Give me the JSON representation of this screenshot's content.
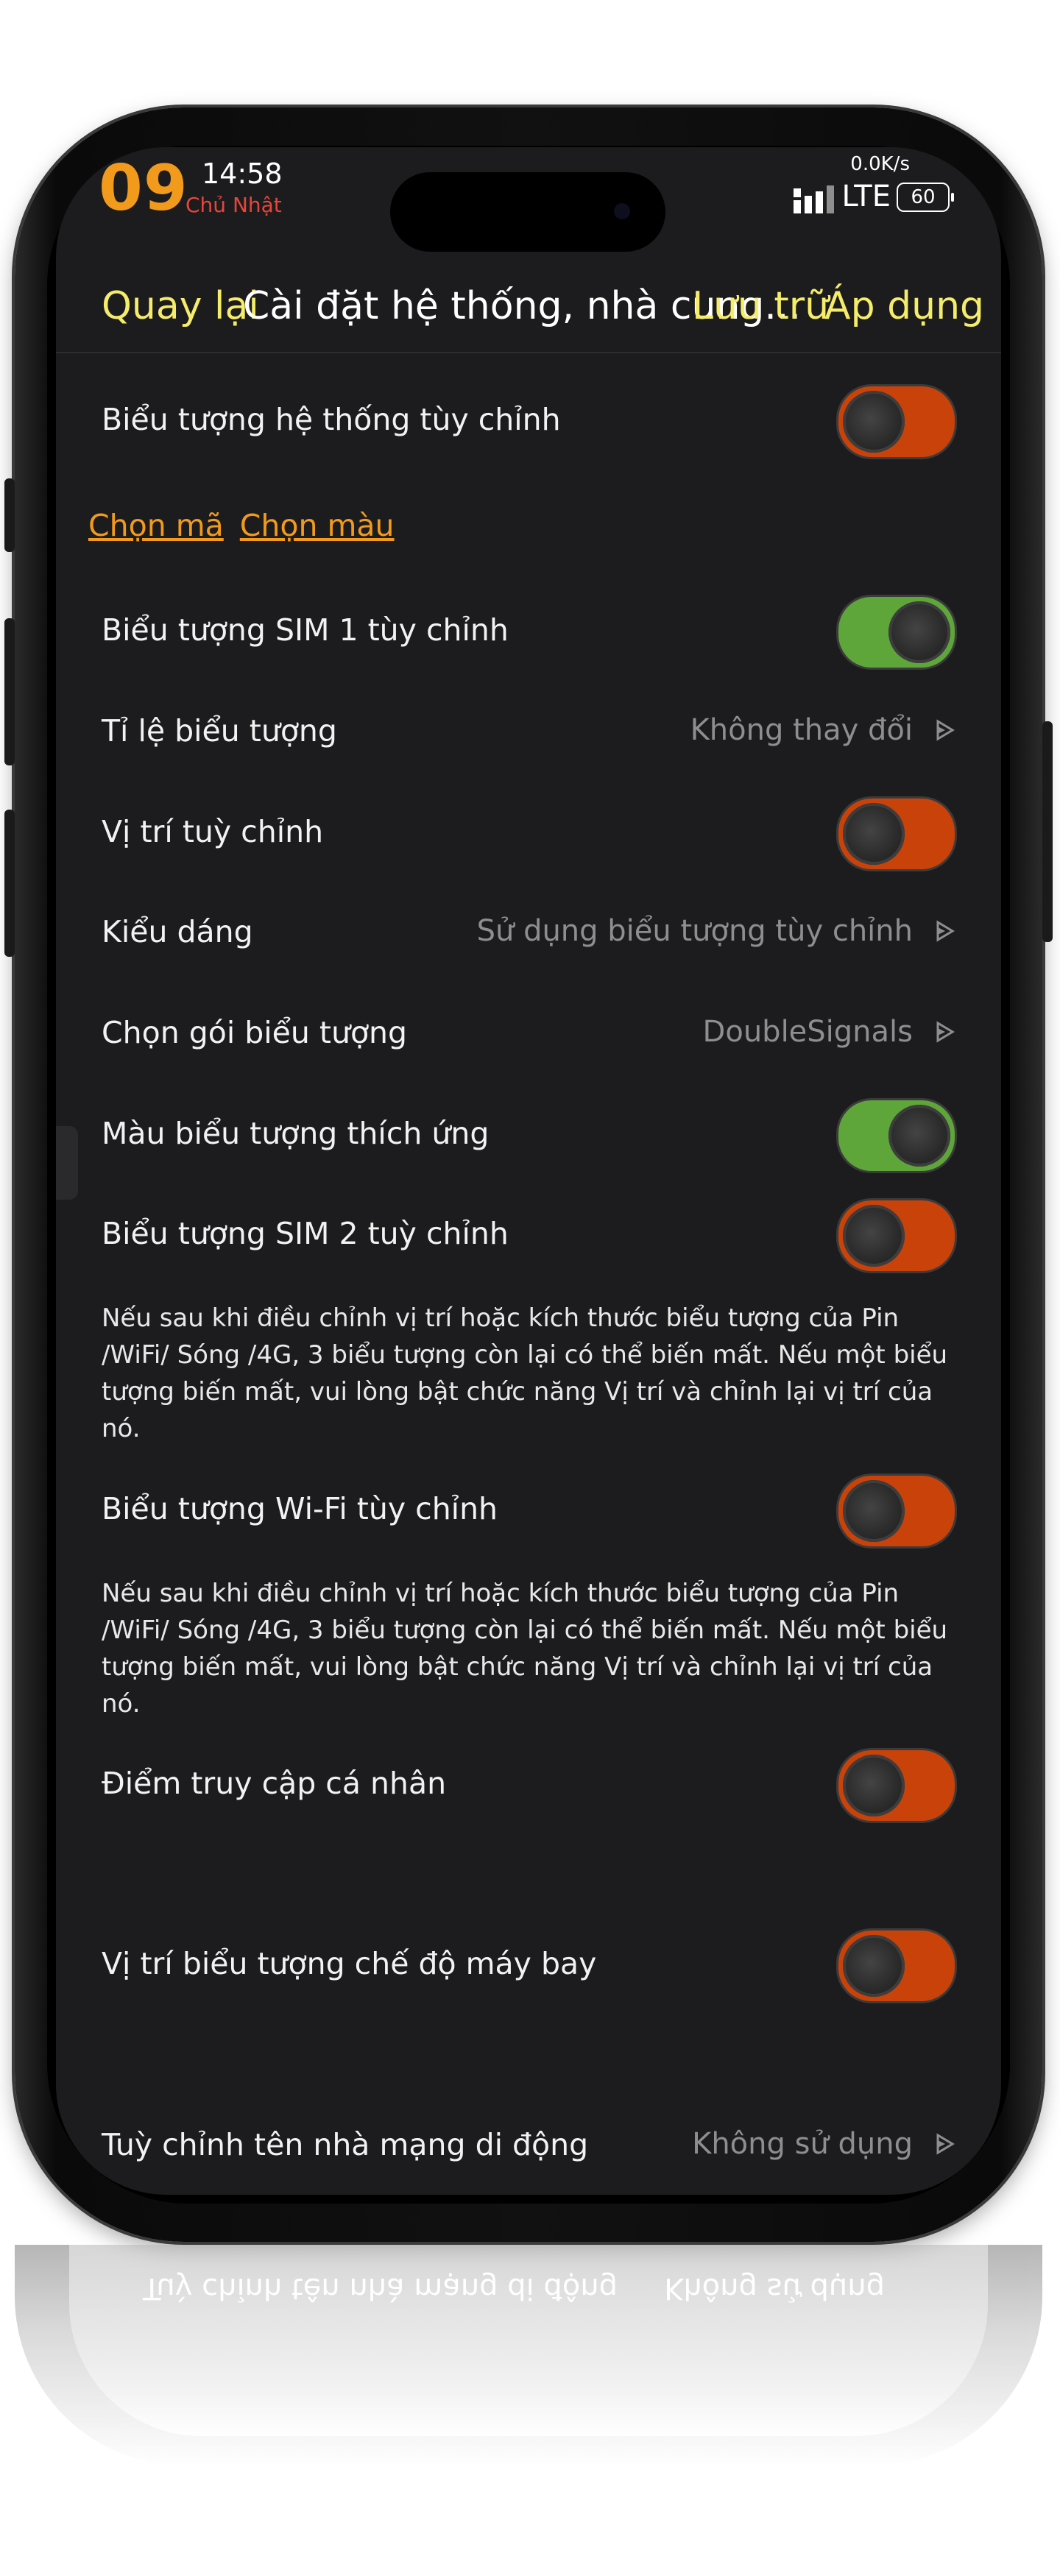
{
  "status_bar": {
    "day": "09",
    "time": "14:58",
    "weekday": "Chủ Nhật",
    "speed": "0.0K/s",
    "network": "LTE",
    "battery": "60"
  },
  "nav": {
    "back": "Quay lại",
    "title": "Cài đặt hệ thống, nhà cung...",
    "save": "Lưu trữ",
    "apply": "Áp dụng"
  },
  "settings": {
    "custom_system_icons": {
      "label": "Biểu tượng hệ thống tùy chỉnh",
      "enabled": false
    },
    "links": {
      "choose_code": "Chọn mã",
      "choose_color": "Chọn màu"
    },
    "custom_sim1_icon": {
      "label": "Biểu tượng SIM 1 tùy chỉnh",
      "enabled": true
    },
    "icon_ratio": {
      "label": "Tỉ lệ biểu tượng",
      "value": "Không thay đổi"
    },
    "custom_position": {
      "label": "Vị trí tuỳ chỉnh",
      "enabled": false
    },
    "style": {
      "label": "Kiểu dáng",
      "value": "Sử dụng biểu tượng tùy chỉnh"
    },
    "icon_pack": {
      "label": "Chọn gói biểu tượng",
      "value": "DoubleSignals"
    },
    "adaptive_color": {
      "label": "Màu biểu tượng thích ứng",
      "enabled": true
    },
    "custom_sim2_icon": {
      "label": "Biểu tượng SIM 2 tuỳ chỉnh",
      "enabled": false
    },
    "note_sim2": "Nếu sau khi điều chỉnh vị trí hoặc kích thước biểu tượng của Pin /WiFi/ Sóng /4G, 3 biểu tượng còn lại có thể biến mất. Nếu một biểu tượng biến mất, vui lòng bật chức năng Vị trí và chỉnh lại vị trí của nó.",
    "custom_wifi_icon": {
      "label": "Biểu tượng Wi-Fi tùy chỉnh",
      "enabled": false
    },
    "note_wifi": "Nếu sau khi điều chỉnh vị trí hoặc kích thước biểu tượng của Pin /WiFi/ Sóng /4G, 3 biểu tượng còn lại có thể biến mất. Nếu một biểu tượng biến mất, vui lòng bật chức năng Vị trí và chỉnh lại vị trí của nó.",
    "hotspot": {
      "label": "Điểm truy cập cá nhân",
      "enabled": false
    },
    "airplane_position": {
      "label": "Vị trí biểu tượng chế độ máy bay",
      "enabled": false
    },
    "carrier_name": {
      "label": "Tuỳ chỉnh tên nhà mạng di động",
      "value": "Không sử dụng"
    }
  },
  "colors": {
    "accent_yellow": "#f5ec6a",
    "accent_orange": "#f29a1b",
    "toggle_off": "#c8420a",
    "toggle_on": "#5ea63a",
    "background": "#1c1c1e"
  }
}
